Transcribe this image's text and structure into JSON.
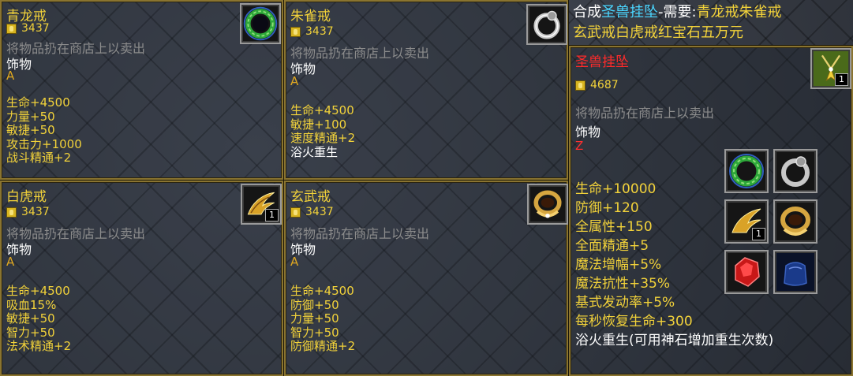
{
  "common": {
    "sell_hint": "将物品扔在商店上以卖出",
    "item_type": "饰物"
  },
  "panels": {
    "qinglong": {
      "name": "青龙戒",
      "price": "3437",
      "grade": "A",
      "stats": [
        "生命+4500",
        "力量+50",
        "敏捷+50",
        "攻击力+1000",
        "战斗精通+2"
      ],
      "icon": "green-ring-icon"
    },
    "zhuque": {
      "name": "朱雀戒",
      "price": "3437",
      "grade": "A",
      "stats": [
        "生命+4500",
        "敏捷+100",
        "速度精通+2",
        "浴火重生"
      ],
      "icon": "silver-ring-icon"
    },
    "baihu": {
      "name": "白虎戒",
      "price": "3437",
      "grade": "A",
      "stats": [
        "生命+4500",
        "吸血15%",
        "敏捷+50",
        "智力+50",
        "法术精通+2"
      ],
      "icon": "golden-wing-icon",
      "qty": "1"
    },
    "xuanwu": {
      "name": "玄武戒",
      "price": "3437",
      "grade": "A",
      "stats": [
        "生命+4500",
        "防御+50",
        "力量+50",
        "智力+50",
        "防御精通+2"
      ],
      "icon": "gold-ring-icon"
    }
  },
  "recipe": {
    "prefix": "合成",
    "target": "圣兽挂坠",
    "need": "-需要:",
    "ingredients_line1": "青龙戒朱雀戒",
    "ingredients_line2": "玄武戒白虎戒红宝石五万元"
  },
  "pendant": {
    "name": "圣兽挂坠",
    "price": "4687",
    "grade": "Z",
    "qty": "1",
    "icon": "pendant-icon",
    "stats": [
      "生命+10000",
      "防御+120",
      "全属性+150",
      "全面精通+5",
      "魔法增幅+5%",
      "魔法抗性+35%",
      "基式发动率+5%",
      "每秒恢复生命+300"
    ],
    "special": "浴火重生(可用神石增加重生次数)",
    "ingredient_icons": [
      "green-ring-icon",
      "silver-ring-icon",
      "golden-wing-icon",
      "gold-ring-icon",
      "ruby-icon",
      "blue-pouch-icon"
    ],
    "wing_qty": "1"
  }
}
